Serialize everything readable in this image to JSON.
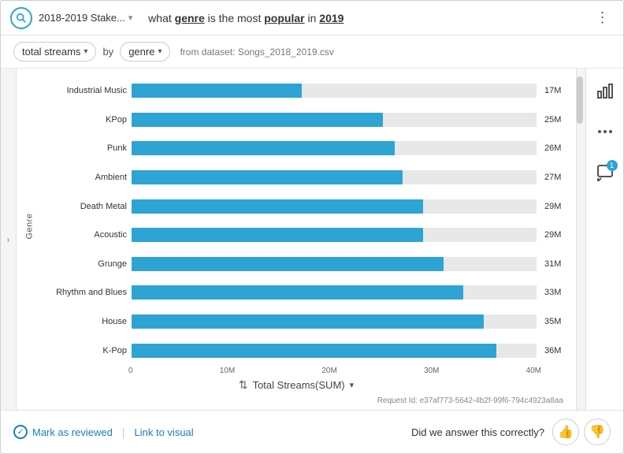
{
  "header": {
    "breadcrumb": "2018-2019 Stake...",
    "query_prefix": "what",
    "query_keyword1": "genre",
    "query_middle": "is the most",
    "query_keyword2": "popular",
    "query_suffix": "in",
    "query_year": "2019",
    "more_icon": "⋮"
  },
  "filter_bar": {
    "metric_label": "total streams",
    "by_label": "by",
    "group_label": "genre",
    "dataset_info": "from dataset: Songs_2018_2019.csv"
  },
  "chart": {
    "y_axis_label": "Genre",
    "x_axis_title": "Total Streams(SUM)",
    "x_ticks": [
      "0",
      "10M",
      "20M",
      "30M",
      "40M"
    ],
    "bars": [
      {
        "label": "Industrial Music",
        "value": "17M",
        "pct": 42
      },
      {
        "label": "KPop",
        "value": "25M",
        "pct": 62
      },
      {
        "label": "Punk",
        "value": "26M",
        "pct": 65
      },
      {
        "label": "Ambient",
        "value": "27M",
        "pct": 67
      },
      {
        "label": "Death Metal",
        "value": "29M",
        "pct": 72
      },
      {
        "label": "Acoustic",
        "value": "29M",
        "pct": 72
      },
      {
        "label": "Grunge",
        "value": "31M",
        "pct": 77
      },
      {
        "label": "Rhythm and Blues",
        "value": "33M",
        "pct": 82
      },
      {
        "label": "House",
        "value": "35M",
        "pct": 87
      },
      {
        "label": "K-Pop",
        "value": "36M",
        "pct": 90
      }
    ],
    "request_id": "Request Id: e37af773-5642-4b2f-99f6-794c4923a8aa"
  },
  "sidebar": {
    "chart_icon": "📊",
    "more_icon": "⋯",
    "comment_icon": "💬",
    "comment_badge": "1"
  },
  "footer": {
    "mark_reviewed_label": "Mark as reviewed",
    "link_visual_label": "Link to visual",
    "feedback_question": "Did we answer this correctly?",
    "thumbs_up_label": "👍",
    "thumbs_down_label": "👎"
  }
}
